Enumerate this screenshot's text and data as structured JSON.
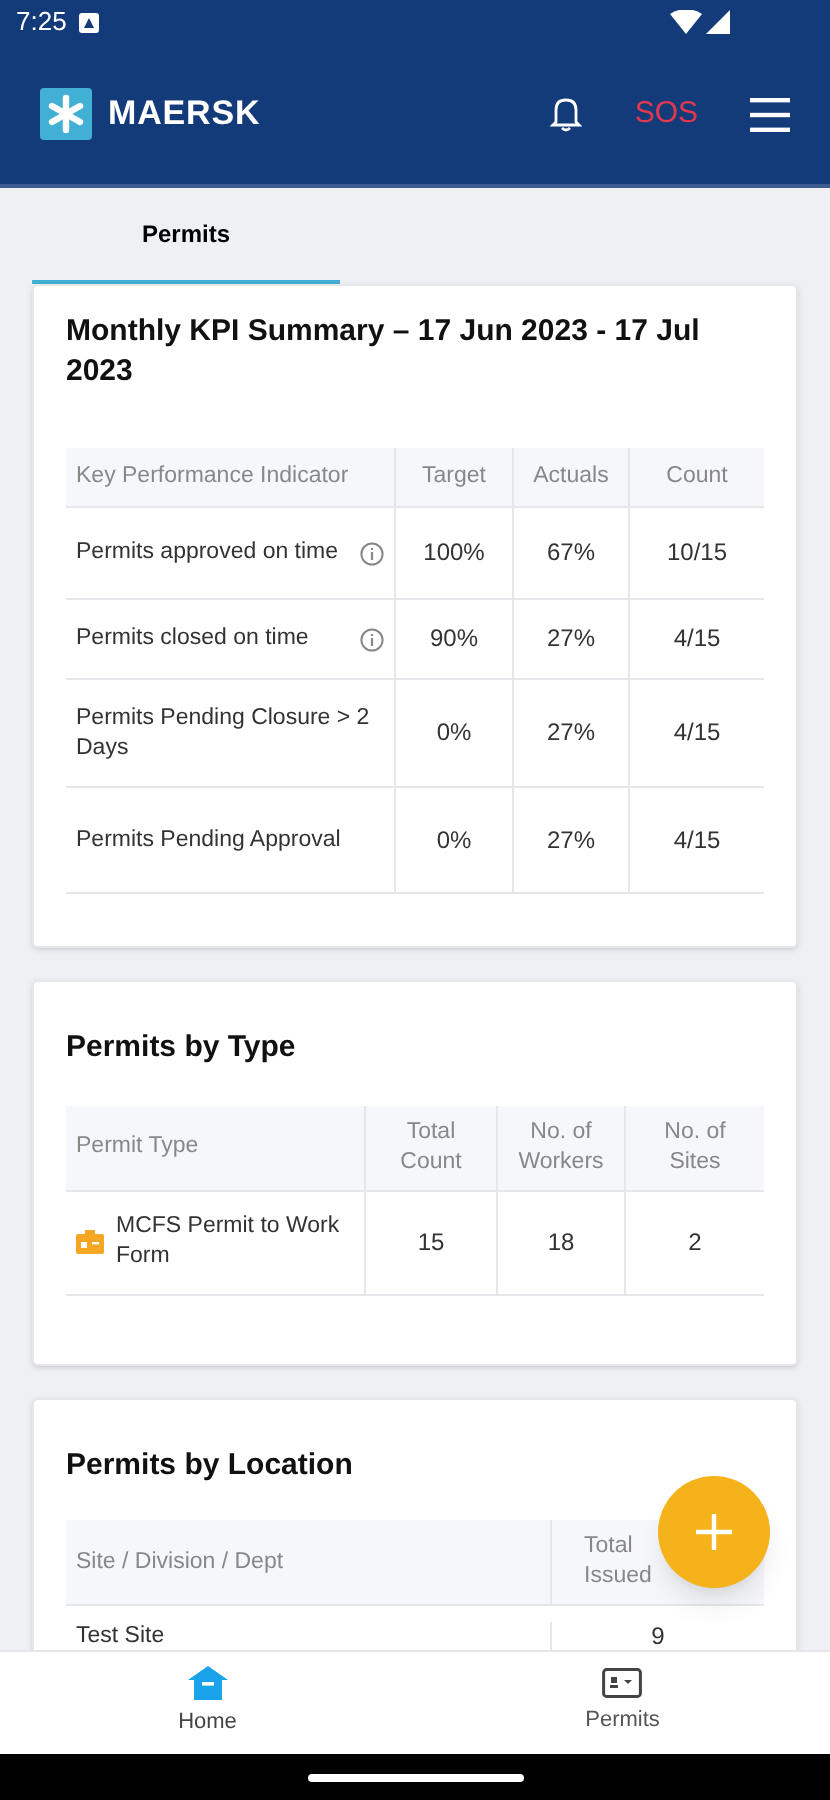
{
  "status_bar": {
    "time": "7:25"
  },
  "header": {
    "brand": "MAERSK",
    "sos": "SOS"
  },
  "tabs": [
    {
      "label": "Permits",
      "selected": true
    }
  ],
  "kpi_card": {
    "title": "Monthly KPI Summary – 17 Jun 2023 - 17 Jul 2023",
    "columns": [
      "Key Performance Indicator",
      "Target",
      "Actuals",
      "Count"
    ],
    "rows": [
      {
        "kpi": "Permits approved on time",
        "info": true,
        "target": "100%",
        "actuals": "67%",
        "count": "10/15"
      },
      {
        "kpi": "Permits closed on time",
        "info": true,
        "target": "90%",
        "actuals": "27%",
        "count": "4/15"
      },
      {
        "kpi": "Permits Pending Closure > 2 Days",
        "info": false,
        "target": "0%",
        "actuals": "27%",
        "count": "4/15"
      },
      {
        "kpi": "Permits Pending Approval",
        "info": false,
        "target": "0%",
        "actuals": "27%",
        "count": "4/15"
      }
    ]
  },
  "type_card": {
    "title": "Permits by Type",
    "columns": [
      "Permit Type",
      "Total Count",
      "No. of Workers",
      "No. of Sites"
    ],
    "rows": [
      {
        "type": "MCFS Permit to Work Form",
        "total": "15",
        "workers": "18",
        "sites": "2"
      }
    ]
  },
  "location_card": {
    "title": "Permits by Location",
    "columns": [
      "Site / Division / Dept",
      "Total\nIssued"
    ],
    "rows": [
      {
        "site": "Test Site",
        "issued": "9"
      }
    ]
  },
  "bottom_nav": [
    {
      "label": "Home",
      "kind": "home",
      "selected": true
    },
    {
      "label": "Permits",
      "kind": "permits",
      "selected": false
    }
  ]
}
